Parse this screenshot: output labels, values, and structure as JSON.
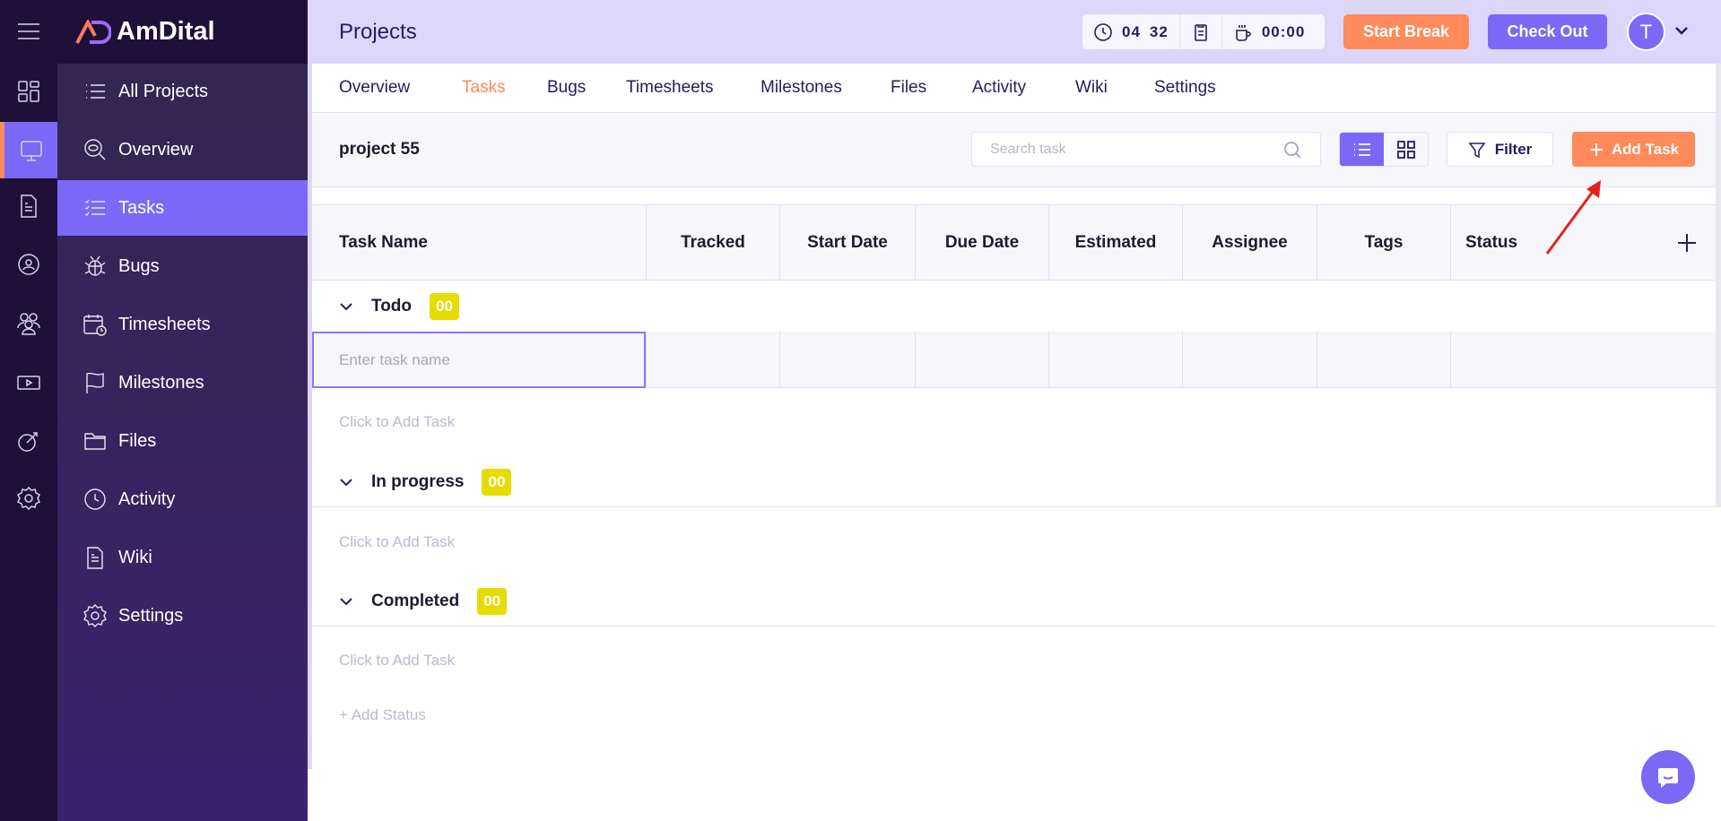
{
  "brand": {
    "name": "AmDital"
  },
  "header": {
    "title": "Projects",
    "timer_hours": "04",
    "timer_minutes": "32",
    "break_time": "00:00",
    "start_break": "Start Break",
    "check_out": "Check Out",
    "avatar_initial": "T"
  },
  "rail": {
    "icons": [
      "dashboard-icon",
      "projects-icon",
      "document-icon",
      "team-network-icon",
      "users-icon",
      "video-icon",
      "goal-icon",
      "settings-icon"
    ],
    "active": 1
  },
  "sidebar": {
    "items": [
      {
        "label": "All Projects",
        "icon": "list-icon"
      },
      {
        "label": "Overview",
        "icon": "eye-search-icon"
      },
      {
        "label": "Tasks",
        "icon": "task-list-icon"
      },
      {
        "label": "Bugs",
        "icon": "bug-icon"
      },
      {
        "label": "Timesheets",
        "icon": "calendar-clock-icon"
      },
      {
        "label": "Milestones",
        "icon": "flag-icon"
      },
      {
        "label": "Files",
        "icon": "folder-icon"
      },
      {
        "label": "Activity",
        "icon": "clock-icon"
      },
      {
        "label": "Wiki",
        "icon": "document-icon"
      },
      {
        "label": "Settings",
        "icon": "gear-icon"
      }
    ],
    "active": 2
  },
  "tabs": [
    "Overview",
    "Tasks",
    "Bugs",
    "Timesheets",
    "Milestones",
    "Files",
    "Activity",
    "Wiki",
    "Settings"
  ],
  "active_tab": "Tasks",
  "toolbar": {
    "project_name": "project 55",
    "search_placeholder": "Search task",
    "filter": "Filter",
    "add_task": "Add Task"
  },
  "table": {
    "columns": [
      "Task Name",
      "Tracked",
      "Start Date",
      "Due Date",
      "Estimated",
      "Assignee",
      "Tags",
      "Status"
    ]
  },
  "groups": [
    {
      "name": "Todo",
      "count": "00",
      "add_label": "Click to Add Task"
    },
    {
      "name": "In progress",
      "count": "00",
      "add_label": "Click to Add Task"
    },
    {
      "name": "Completed",
      "count": "00",
      "add_label": "Click to Add Task"
    }
  ],
  "new_task": {
    "placeholder": "Enter task name",
    "value": ""
  },
  "add_status": "+ Add Status",
  "colors": {
    "accent": "#7b68f7",
    "orange": "#ff8a5b",
    "badge": "#e6dc00",
    "header": "#ddd6fb",
    "rail": "#1e1038"
  }
}
